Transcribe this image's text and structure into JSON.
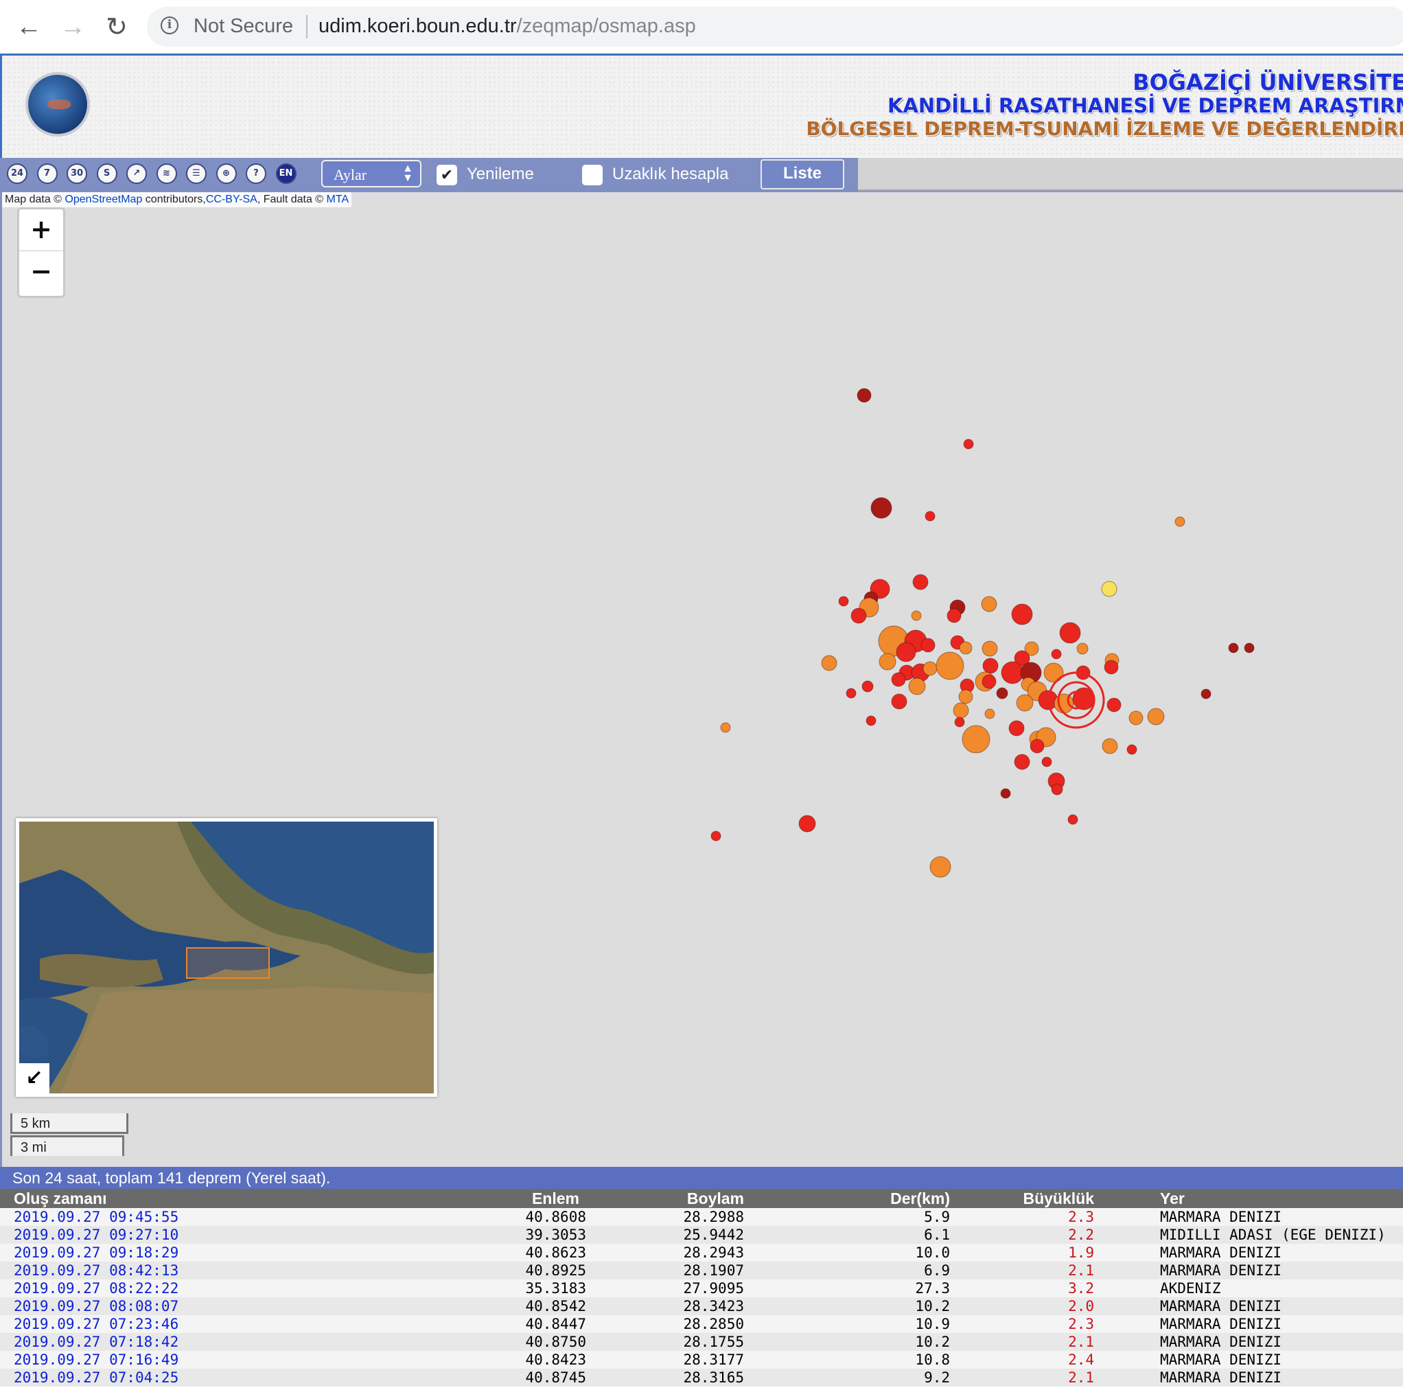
{
  "browser": {
    "security_label": "Not Secure",
    "url_host": "udim.koeri.boun.edu.tr",
    "url_path": "/zeqmap/osmap.asp"
  },
  "banner": {
    "title_1": "BOĞAZİÇİ ÜNİVERSİTESİ",
    "title_2": "KANDİLLİ RASATHANESİ VE DEPREM ARAŞTIRMA",
    "title_3": "BÖLGESEL DEPREM-TSUNAMİ İZLEME VE DEĞERLENDİRME"
  },
  "toolbar": {
    "icons": [
      {
        "name": "24-hours-icon",
        "glyph": "24"
      },
      {
        "name": "7-days-icon",
        "glyph": "7"
      },
      {
        "name": "30-days-icon",
        "glyph": "30"
      },
      {
        "name": "s-icon",
        "glyph": "S"
      },
      {
        "name": "compass-icon",
        "glyph": "↗"
      },
      {
        "name": "layers-icon",
        "glyph": "≋"
      },
      {
        "name": "list-icon",
        "glyph": "☰"
      },
      {
        "name": "locate-icon",
        "glyph": "⊕"
      },
      {
        "name": "help-icon",
        "glyph": "?"
      },
      {
        "name": "english-icon",
        "glyph": "EN"
      }
    ],
    "select_value": "Aylar",
    "refresh_label": "Yenileme",
    "refresh_checked": true,
    "distance_label": "Uzaklık hesapla",
    "distance_checked": false,
    "list_button": "Liste"
  },
  "map": {
    "attribution_prefix": "Map data © ",
    "osm_link": "OpenStreetMap",
    "attribution_mid": " contributors,",
    "license_link": "CC-BY-SA",
    "attribution_fault": ", Fault data © ",
    "mta_link": "MTA",
    "zoom_in": "+",
    "zoom_out": "−",
    "minimap_toggle": "↙",
    "scale_km": "5 km",
    "scale_mi": "3 mi"
  },
  "colors": {
    "dark_red": "#a81a16",
    "red": "#e8251f",
    "orange": "#f08a2c",
    "yellow": "#f7e35a",
    "magnitude_text": "#c8141d",
    "date_link": "#0b1fd4",
    "summary_bar": "#5a6fc0"
  },
  "summary": "Son 24 saat, toplam 141 deprem (Yerel saat).",
  "table": {
    "headers": [
      "Oluş zamanı",
      "Enlem",
      "Boylam",
      "Der(km)",
      "Büyüklük",
      "Yer"
    ],
    "rows": [
      [
        "2019.09.27 09:45:55",
        "40.8608",
        "28.2988",
        "5.9",
        "2.3",
        "MARMARA DENIZI"
      ],
      [
        "2019.09.27 09:27:10",
        "39.3053",
        "25.9442",
        "6.1",
        "2.2",
        "MIDILLI ADASI (EGE DENIZI)"
      ],
      [
        "2019.09.27 09:18:29",
        "40.8623",
        "28.2943",
        "10.0",
        "1.9",
        "MARMARA DENIZI"
      ],
      [
        "2019.09.27 08:42:13",
        "40.8925",
        "28.1907",
        "6.9",
        "2.1",
        "MARMARA DENIZI"
      ],
      [
        "2019.09.27 08:22:22",
        "35.3183",
        "27.9095",
        "27.3",
        "3.2",
        "AKDENIZ"
      ],
      [
        "2019.09.27 08:08:07",
        "40.8542",
        "28.3423",
        "10.2",
        "2.0",
        "MARMARA DENIZI"
      ],
      [
        "2019.09.27 07:23:46",
        "40.8447",
        "28.2850",
        "10.9",
        "2.3",
        "MARMARA DENIZI"
      ],
      [
        "2019.09.27 07:18:42",
        "40.8750",
        "28.1755",
        "10.2",
        "2.1",
        "MARMARA DENIZI"
      ],
      [
        "2019.09.27 07:16:49",
        "40.8423",
        "28.3177",
        "10.8",
        "2.4",
        "MARMARA DENIZI"
      ],
      [
        "2019.09.27 07:04:25",
        "40.8745",
        "28.3165",
        "9.2",
        "2.1",
        "MARMARA DENIZI"
      ]
    ]
  }
}
